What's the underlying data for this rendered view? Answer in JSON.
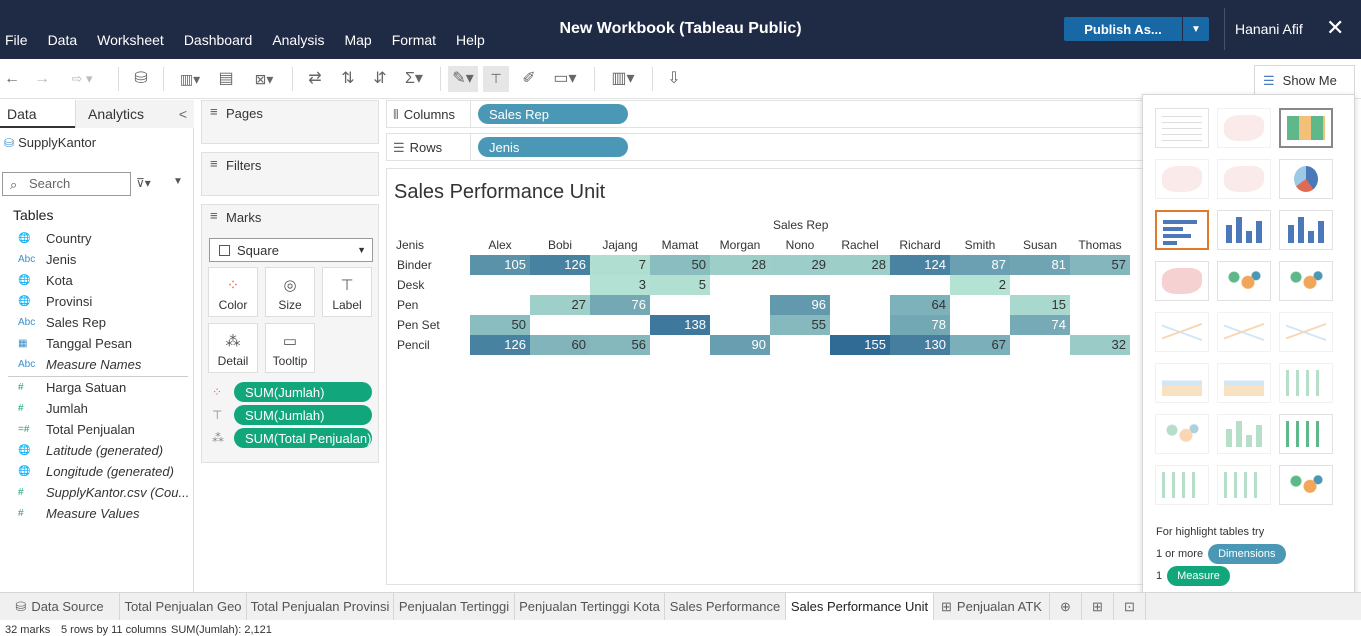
{
  "window": {
    "title": "New Workbook (Tableau Public)",
    "publish_label": "Publish As...",
    "user": "Hanani Afif"
  },
  "menu": [
    "File",
    "Data",
    "Worksheet",
    "Dashboard",
    "Analysis",
    "Map",
    "Format",
    "Help"
  ],
  "toolbar": {
    "show_me_label": "Show Me"
  },
  "data_pane": {
    "tab_data": "Data",
    "tab_analytics": "Analytics",
    "source": "SupplyKantor",
    "search_placeholder": "Search",
    "tables_heading": "Tables",
    "dimensions": [
      {
        "icon": "globe-icon",
        "type": "geo",
        "name": "Country"
      },
      {
        "icon": "abc-icon",
        "type": "abc",
        "name": "Jenis"
      },
      {
        "icon": "globe-icon",
        "type": "geo",
        "name": "Kota"
      },
      {
        "icon": "globe-icon",
        "type": "geo",
        "name": "Provinsi"
      },
      {
        "icon": "abc-icon",
        "type": "abc",
        "name": "Sales Rep"
      },
      {
        "icon": "calendar-icon",
        "type": "date",
        "name": "Tanggal Pesan"
      },
      {
        "icon": "abc-icon",
        "type": "abc",
        "name": "Measure Names",
        "italic": true
      }
    ],
    "measures": [
      {
        "icon": "hash-icon",
        "type": "num",
        "name": "Harga Satuan"
      },
      {
        "icon": "hash-icon",
        "type": "num",
        "name": "Jumlah"
      },
      {
        "icon": "calc-hash-icon",
        "type": "calc",
        "name": "Total Penjualan"
      },
      {
        "icon": "globe-icon",
        "type": "geo",
        "name": "Latitude (generated)",
        "italic": true
      },
      {
        "icon": "globe-icon",
        "type": "geo",
        "name": "Longitude (generated)",
        "italic": true
      },
      {
        "icon": "hash-icon",
        "type": "num",
        "name": "SupplyKantor.csv (Cou...",
        "italic": true
      },
      {
        "icon": "hash-icon",
        "type": "num",
        "name": "Measure Values",
        "italic": true
      }
    ]
  },
  "cards": {
    "pages": "Pages",
    "filters": "Filters",
    "marks": "Marks",
    "mark_type": "Square",
    "buttons": [
      "Color",
      "Size",
      "Label",
      "Detail",
      "Tooltip"
    ],
    "pills": [
      {
        "icon": "color-icon",
        "label": "SUM(Jumlah)"
      },
      {
        "icon": "label-icon",
        "label": "SUM(Jumlah)"
      },
      {
        "icon": "detail-icon",
        "label": "SUM(Total Penjualan)"
      }
    ]
  },
  "shelves": {
    "columns_label": "Columns",
    "columns_pill": "Sales Rep",
    "rows_label": "Rows",
    "rows_pill": "Jenis"
  },
  "view": {
    "title": "Sales Performance Unit",
    "column_header_title": "Sales Rep",
    "row_header_title": "Jenis"
  },
  "chart_data": {
    "type": "heatmap",
    "title": "Sales Performance Unit",
    "xlabel": "Sales Rep",
    "ylabel": "Jenis",
    "x": [
      "Alex",
      "Bobi",
      "Jajang",
      "Mamat",
      "Morgan",
      "Nono",
      "Rachel",
      "Richard",
      "Smith",
      "Susan",
      "Thomas"
    ],
    "y": [
      "Binder",
      "Desk",
      "Pen",
      "Pen Set",
      "Pencil"
    ],
    "values": [
      [
        105,
        126,
        7,
        50,
        28,
        29,
        28,
        124,
        87,
        81,
        57
      ],
      [
        null,
        null,
        3,
        5,
        null,
        null,
        null,
        null,
        2,
        null,
        null
      ],
      [
        null,
        27,
        76,
        null,
        null,
        96,
        null,
        64,
        null,
        15,
        null
      ],
      [
        50,
        null,
        null,
        138,
        null,
        55,
        null,
        78,
        null,
        74,
        null
      ],
      [
        126,
        60,
        56,
        null,
        90,
        null,
        155,
        130,
        67,
        null,
        32
      ]
    ],
    "color_range": [
      "#b4e2d3",
      "#2f6b95"
    ],
    "value_range": [
      2,
      155
    ]
  },
  "show_me": {
    "hint_prefix": "For highlight tables try",
    "line1_prefix": "1 or more",
    "line1_pill": "Dimensions",
    "line2_prefix": "1",
    "line2_pill": "Measure",
    "charts": [
      "text-table",
      "symbol-map",
      "highlight-table",
      "filled-map",
      "map-placeholder",
      "pie-chart",
      "horizontal-bars",
      "stacked-bars",
      "side-by-side-bars",
      "treemap",
      "circle-views",
      "side-by-side-circles",
      "continuous-lines",
      "discrete-lines",
      "dual-lines",
      "area-continuous",
      "area-discrete",
      "dual-combination",
      "scatter-plot",
      "histogram",
      "box-whisker",
      "gantt",
      "bullet-graph",
      "packed-bubbles"
    ]
  },
  "sheet_tabs": [
    {
      "label": "Data Source",
      "icon": "database-icon"
    },
    {
      "label": "Total Penjualan Geo"
    },
    {
      "label": "Total Penjualan Provinsi"
    },
    {
      "label": "Penjualan Tertinggi"
    },
    {
      "label": "Penjualan Tertinggi Kota"
    },
    {
      "label": "Sales Performance"
    },
    {
      "label": "Sales Performance Unit",
      "active": true
    },
    {
      "label": "Penjualan ATK",
      "icon": "dashboard-icon"
    }
  ],
  "status": {
    "marks": "32 marks",
    "dims": "5 rows by 11 columns",
    "sum": "SUM(Jumlah): 2,121"
  }
}
